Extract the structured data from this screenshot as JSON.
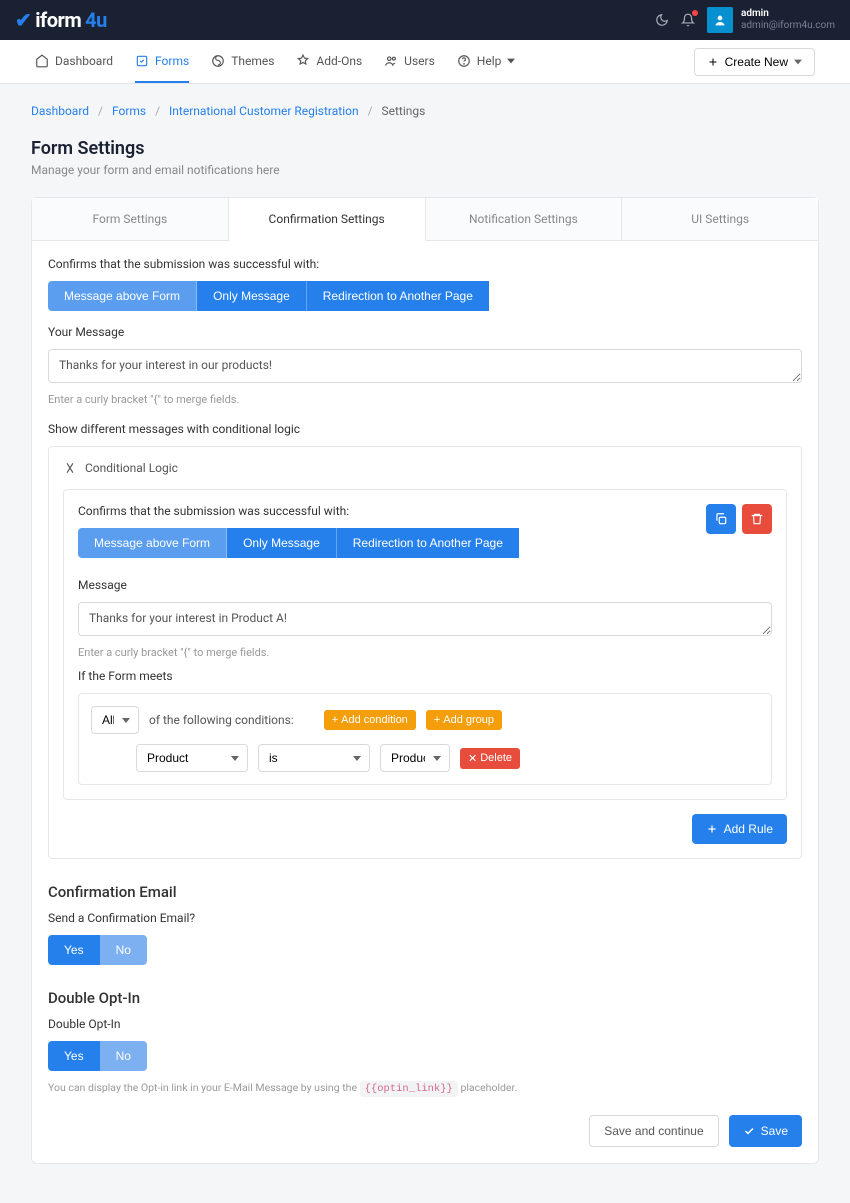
{
  "header": {
    "logo_prefix": "iform",
    "logo_suffix": "4u",
    "admin_name": "admin",
    "admin_email": "admin@iform4u.com"
  },
  "nav": {
    "items": [
      {
        "label": "Dashboard"
      },
      {
        "label": "Forms"
      },
      {
        "label": "Themes"
      },
      {
        "label": "Add-Ons"
      },
      {
        "label": "Users"
      },
      {
        "label": "Help"
      }
    ],
    "create": "Create New"
  },
  "breadcrumb": {
    "a": "Dashboard",
    "b": "Forms",
    "c": "International Customer Registration",
    "d": "Settings"
  },
  "page": {
    "title": "Form Settings",
    "subtitle": "Manage your form and email notifications here"
  },
  "tabs": {
    "t0": "Form Settings",
    "t1": "Confirmation Settings",
    "t2": "Notification Settings",
    "t3": "UI Settings"
  },
  "confirm": {
    "label1": "Confirms that the submission was successful with:",
    "opt0": "Message above Form",
    "opt1": "Only Message",
    "opt2": "Redirection to Another Page",
    "your_message_label": "Your Message",
    "your_message_value": "Thanks for your interest in our products!",
    "helper": "Enter a curly bracket \"{\" to merge fields.",
    "show_diff": "Show different messages with conditional logic",
    "cond_title": "Conditional Logic",
    "message_label": "Message",
    "message_value": "Thanks for your interest in Product A!",
    "if_meets": "If the Form meets",
    "all": "All",
    "of_following": "of the following conditions:",
    "add_cond": "Add condition",
    "add_group": "Add group",
    "product": "Product",
    "is": "is",
    "product_a": "Product A",
    "delete": "Delete",
    "add_rule": "Add Rule"
  },
  "email": {
    "title": "Confirmation Email",
    "question": "Send a Confirmation Email?",
    "yes": "Yes",
    "no": "No"
  },
  "optin": {
    "title": "Double Opt-In",
    "label": "Double Opt-In",
    "yes": "Yes",
    "no": "No",
    "note_pre": "You can display the Opt-in link in your E-Mail Message by using the",
    "note_code": "{{optin_link}}",
    "note_post": "placeholder."
  },
  "footer": {
    "save_cont": "Save and continue",
    "save": "Save"
  }
}
